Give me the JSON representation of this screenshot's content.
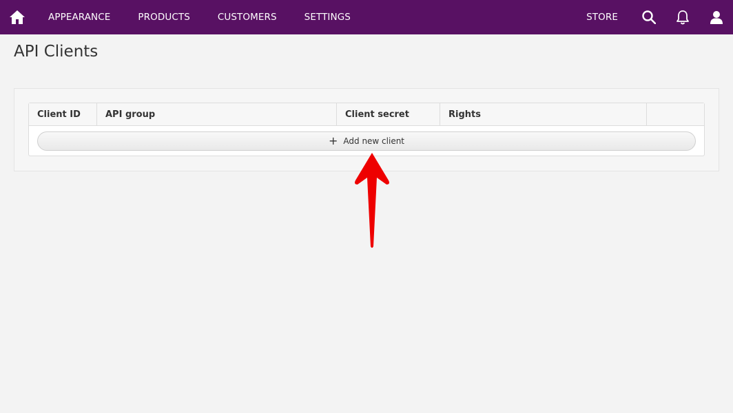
{
  "nav": {
    "items": [
      "APPEARANCE",
      "PRODUCTS",
      "CUSTOMERS",
      "SETTINGS"
    ],
    "store_label": "STORE"
  },
  "page": {
    "title": "API Clients"
  },
  "table": {
    "columns": [
      "Client ID",
      "API group",
      "Client secret",
      "Rights",
      ""
    ],
    "add_label": "Add new client"
  },
  "colors": {
    "topbar": "#581163",
    "arrow": "#ee0000"
  }
}
